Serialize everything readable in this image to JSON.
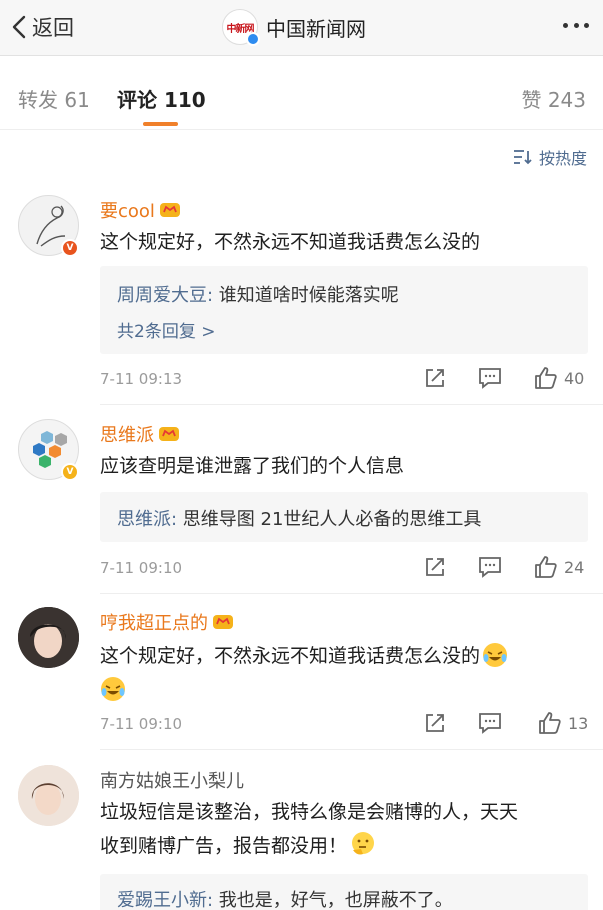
{
  "nav": {
    "back_label": "返回",
    "title": "中国新闻网",
    "logo_text": "中新网"
  },
  "tabs": {
    "repost": "转发 61",
    "comment": "评论 110",
    "like": "赞 243"
  },
  "sort_label": "按热度",
  "comments": [
    {
      "username": "要cool",
      "text": "这个规定好，不然永远不知道我话费怎么没的",
      "reply_author": "周周爱大豆:",
      "reply_text": " 谁知道啥时候能落实呢",
      "reply_more": "共2条回复 >",
      "time": "7-11 09:13",
      "likes": "40"
    },
    {
      "username": "思维派",
      "text": "应该查明是谁泄露了我们的个人信息",
      "reply_author": "思维派:",
      "reply_text": " 思维导图 21世纪人人必备的思维工具",
      "time": "7-11 09:10",
      "likes": "24"
    },
    {
      "username": "哼我超正点的",
      "text": "这个规定好，不然永远不知道我话费怎么没的",
      "time": "7-11 09:10",
      "likes": "13"
    },
    {
      "username": "南方姑娘王小梨儿",
      "text_line1": "垃圾短信是该整治，我特么像是会赌博的人，天天",
      "text_line2": "收到赌博广告，报告都没用！",
      "reply_author": "爱踢王小新:",
      "reply_text": " 我也是，好气，也屏蔽不了。"
    }
  ],
  "colors": {
    "accent": "#f0802a",
    "username": "#e9781c",
    "link": "#506c90"
  }
}
